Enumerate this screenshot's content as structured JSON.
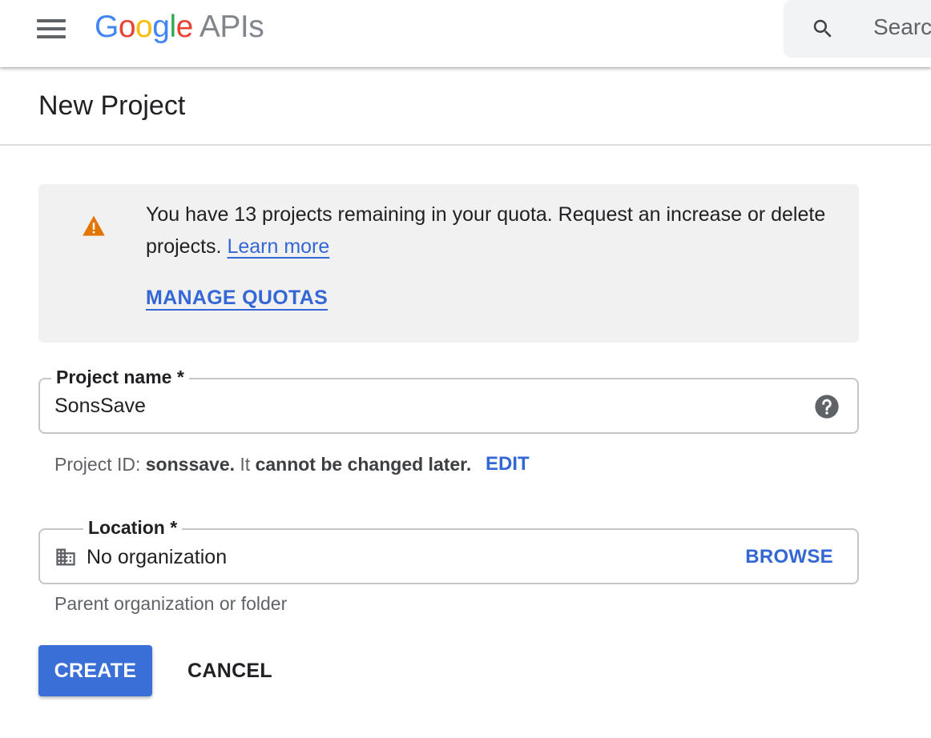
{
  "header": {
    "logo": {
      "letters": [
        "G",
        "o",
        "o",
        "g",
        "l",
        "e"
      ],
      "suffix": "APIs"
    },
    "menu_icon": "hamburger-menu-icon",
    "search": {
      "icon": "search-icon",
      "placeholder": "Search"
    }
  },
  "page": {
    "title": "New Project"
  },
  "quota_banner": {
    "icon": "warning-icon",
    "message": "You have 13 projects remaining in your quota. Request an increase or delete projects.",
    "learn_more": "Learn more",
    "manage_quotas": "MANAGE QUOTAS"
  },
  "project_name_field": {
    "label": "Project name *",
    "value": "SonsSave",
    "help_icon": "help-icon"
  },
  "project_id": {
    "prefix": "Project ID:",
    "id": "sonssave.",
    "middle": "It",
    "note": "cannot be changed later.",
    "edit_label": "EDIT"
  },
  "location_field": {
    "label": "Location *",
    "icon": "building-icon",
    "value": "No organization",
    "browse_label": "BROWSE",
    "helper": "Parent organization or folder"
  },
  "actions": {
    "create_label": "CREATE",
    "cancel_label": "CANCEL"
  },
  "colors": {
    "accent": "#3367d6",
    "primary_button": "#3b6fd8",
    "warning": "#e37400",
    "banner_background": "#f1f1f1"
  }
}
